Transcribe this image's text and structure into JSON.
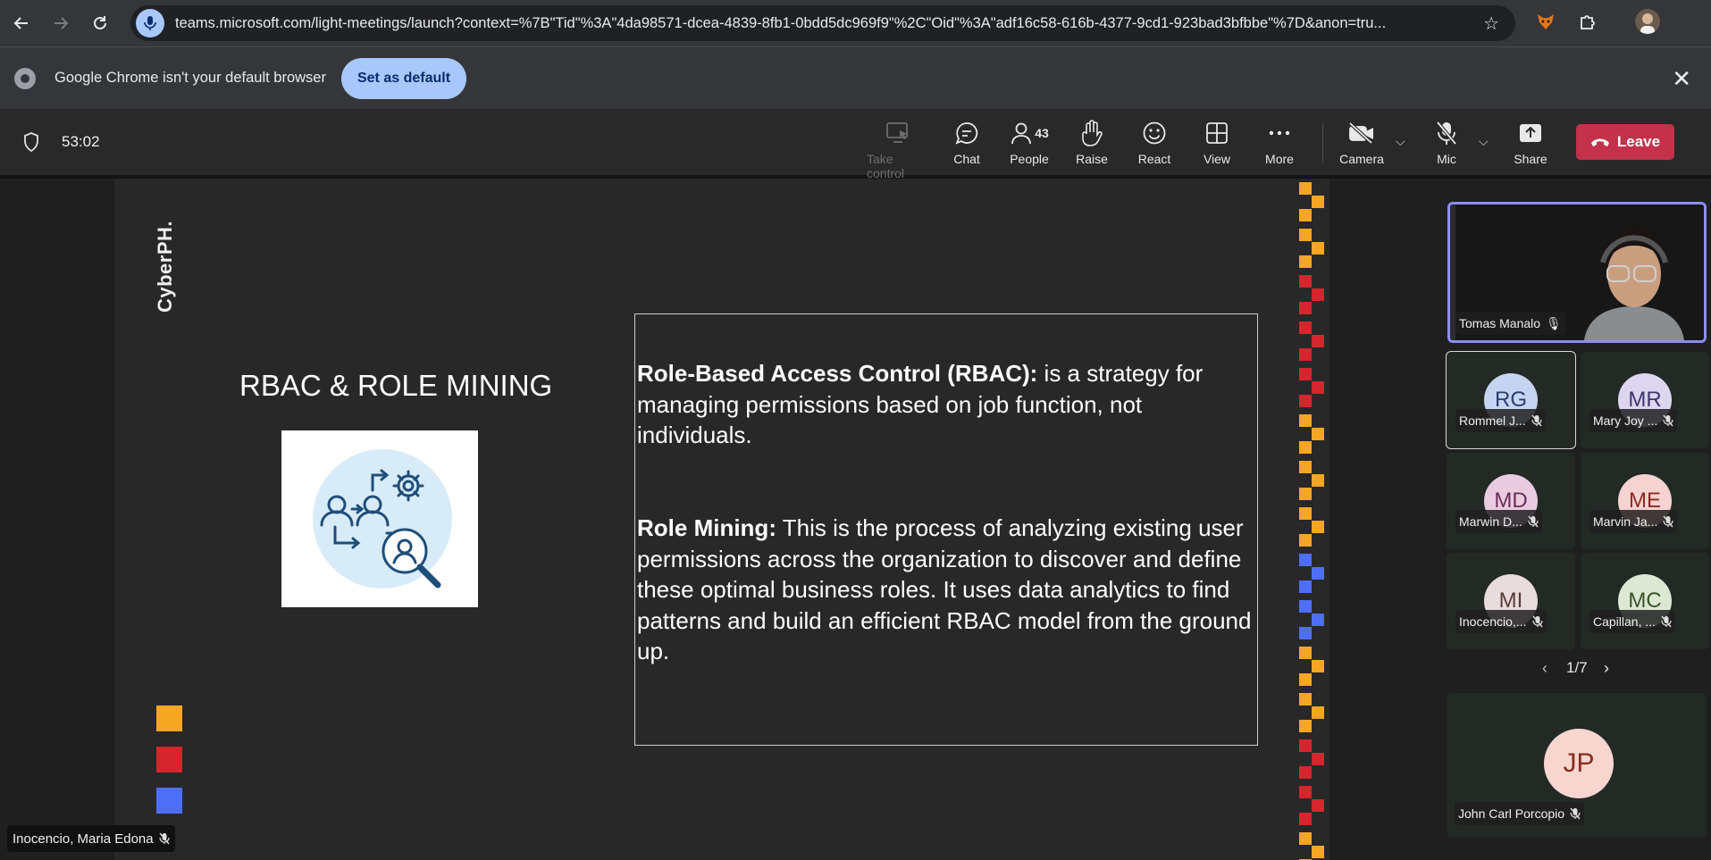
{
  "browser": {
    "url": "teams.microsoft.com/light-meetings/launch?context=%7B\"Tid\"%3A\"4da98571-dcea-4839-8fb1-0bdd5dc969f9\"%2C\"Oid\"%3A\"adf16c58-616b-4377-9cd1-923bad3bfbbe\"%7D&anon=tru...",
    "infobar_text": "Google Chrome isn't your default browser",
    "set_default_label": "Set as default",
    "accent": "#a8c7fa"
  },
  "meeting": {
    "timer": "53:02",
    "tools": {
      "take_control": "Take control",
      "chat": "Chat",
      "people": "People",
      "people_count": "43",
      "raise": "Raise",
      "react": "React",
      "view": "View",
      "more": "More",
      "camera": "Camera",
      "mic": "Mic",
      "share": "Share"
    },
    "leave_label": "Leave",
    "leave_color": "#c4314b"
  },
  "slide": {
    "brand": "CyberPH.",
    "title": "RBAC & ROLE MINING",
    "para1_bold": "Role-Based Access Control (RBAC):",
    "para1_rest": " is a strategy for managing permissions based on job function, not individuals.",
    "para2_bold": "Role Mining:",
    "para2_rest": " This is the process of analyzing existing user permissions across the organization to discover and define these optimal business roles. It uses data analytics to find patterns and build an efficient RBAC model from the ground up.",
    "square_colors": [
      "#f5a623",
      "#d4262c",
      "#4f6ef7"
    ]
  },
  "gallery": {
    "active_speaker": "Tomas Manalo",
    "active_border": "#8e8ef5",
    "participants": [
      {
        "initials": "RG",
        "name": "Rommel J...",
        "bg": "#c5d4f0",
        "fg": "#2b3d70"
      },
      {
        "initials": "MR",
        "name": "Mary Joy ...",
        "bg": "#dcd7ee",
        "fg": "#3e3570"
      },
      {
        "initials": "MD",
        "name": "Marwin D...",
        "bg": "#e9cbe0",
        "fg": "#6b2d5a"
      },
      {
        "initials": "ME",
        "name": "Marvin Ja...",
        "bg": "#f5d3d0",
        "fg": "#8a2c24"
      },
      {
        "initials": "MI",
        "name": "Inocencio,...",
        "bg": "#e8dcdc",
        "fg": "#5a3a3a"
      },
      {
        "initials": "MC",
        "name": "Capillan, ...",
        "bg": "#dde8d4",
        "fg": "#37542a"
      }
    ],
    "page": "1/7",
    "bottom": {
      "initials": "JP",
      "name": "John Carl Porcopio",
      "bg": "#f7d6cf",
      "fg": "#8a2c1e"
    }
  },
  "presenter_name": "Inocencio, Maria Edona"
}
